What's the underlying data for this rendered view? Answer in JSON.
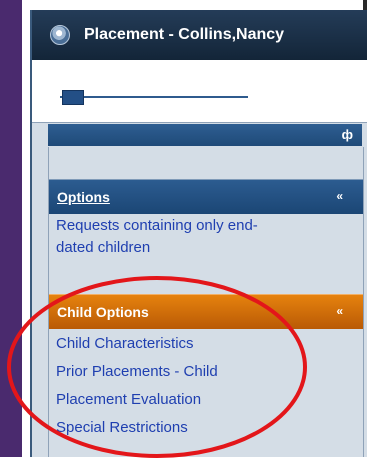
{
  "window": {
    "title": "Placement - Collins,Nancy",
    "icon": "app-globe-icon"
  },
  "slider": {
    "position_fraction": 0.1
  },
  "pane": {
    "pin_icon": "pin-icon",
    "pin_glyph": "ф"
  },
  "sections": [
    {
      "label": "Options",
      "chevron": "«",
      "links": [
        "Requests containing only end-",
        "dated children"
      ]
    },
    {
      "label": "Child Options",
      "chevron": "«",
      "links": [
        "Child Characteristics",
        "Prior Placements - Child",
        "Placement Evaluation",
        "Special Restrictions"
      ]
    }
  ],
  "colors": {
    "accent_blue": "#1b4675",
    "accent_orange": "#e6820e",
    "link": "#1f3fb0",
    "annotation_red": "#e3161a"
  }
}
